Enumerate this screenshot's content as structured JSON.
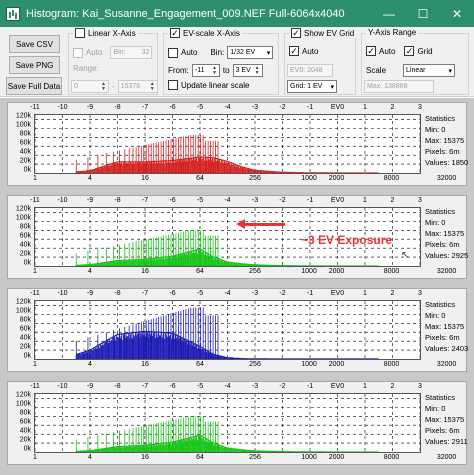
{
  "window": {
    "title": "Histogram: Kai_Susanne_Engagement_009.NEF Full-6064x4040",
    "minimize": "—",
    "maximize": "☐",
    "close": "✕"
  },
  "toolbar": {
    "save_csv": "Save CSV",
    "save_png": "Save PNG",
    "save_full": "Save Full Data",
    "linear_x": {
      "title": "Linear X-Axis",
      "checked": false,
      "auto_label": "Auto",
      "bin_label": "Bin:",
      "bin_value": "32",
      "range_label": "Range:",
      "range_from": "0",
      "range_to": "15376"
    },
    "ev_scale": {
      "title": "EV-scale X-Axis",
      "checked": true,
      "auto_label": "Auto",
      "bin_label": "Bin:",
      "bin_value": "1/32 EV",
      "from_label": "From:",
      "from_value": "-11",
      "to_label": "to",
      "to_value": "3 EV",
      "update_label": "Update linear scale"
    },
    "ev_grid": {
      "title": "Show EV Grid",
      "checked": true,
      "auto_label": "Auto",
      "ev0_value": "EV0: 2048",
      "grid_value": "Grid: 1 EV"
    },
    "y_axis": {
      "title": "Y-Axis Range",
      "auto_label": "Auto",
      "grid_label": "Grid",
      "scale_label": "Scale",
      "scale_value": "Linear",
      "max_value": "Max: 138888"
    }
  },
  "chart_common": {
    "ev_ticks": [
      "-11",
      "-10",
      "-9",
      "-8",
      "-7",
      "-6",
      "-5",
      "-4",
      "-3",
      "-2",
      "-1",
      "EV0",
      "1",
      "2",
      "3"
    ],
    "value_ticks": [
      "1",
      "4",
      "16",
      "64",
      "256",
      "1000",
      "2000",
      "8000",
      "32000"
    ],
    "y_ticks": [
      "120k",
      "100k",
      "80k",
      "60k",
      "40k",
      "20k",
      "0k"
    ]
  },
  "chart_data": [
    {
      "type": "area",
      "channel": "red",
      "color": "#d42020",
      "x": [
        -11,
        -10,
        -9,
        -8,
        -7,
        -6,
        -5,
        -4.5,
        -4,
        -3.5,
        -3,
        -2,
        -1,
        0,
        1,
        2,
        3
      ],
      "y": [
        0,
        0,
        5000,
        25000,
        25000,
        28000,
        36000,
        34000,
        26000,
        14000,
        6000,
        1500,
        300,
        0,
        0,
        0,
        0
      ],
      "spikes_max": 85000,
      "ylim": [
        0,
        130000
      ],
      "stats": {
        "title": "Statistics",
        "min": "Min: 0",
        "max": "Max: 15375",
        "pixels": "Pixels: 6m",
        "values": "Values: 1850"
      }
    },
    {
      "type": "area",
      "channel": "green",
      "color": "#16c416",
      "x": [
        -11,
        -10,
        -9,
        -8,
        -7,
        -6,
        -5,
        -4.5,
        -4,
        -3.5,
        -3,
        -2,
        -1,
        0,
        1,
        2,
        3
      ],
      "y": [
        0,
        0,
        3000,
        12000,
        15000,
        22000,
        38000,
        20000,
        9000,
        5000,
        2500,
        800,
        200,
        0,
        0,
        0,
        0
      ],
      "spikes_max": 80000,
      "ylim": [
        0,
        130000
      ],
      "stats": {
        "title": "Statistics",
        "min": "Min: 0",
        "max": "Max: 15375",
        "pixels": "Pixels: 6m",
        "values": "Values: 2925"
      }
    },
    {
      "type": "area",
      "channel": "blue",
      "color": "#1a1ab4",
      "x": [
        -11,
        -10,
        -9,
        -8,
        -7,
        -6,
        -5,
        -4.5,
        -4,
        -3.5,
        -3,
        -2,
        -1,
        0,
        1,
        2,
        3
      ],
      "y": [
        0,
        0,
        20000,
        55000,
        62000,
        58000,
        28000,
        10000,
        3000,
        800,
        200,
        0,
        0,
        0,
        0,
        0,
        0
      ],
      "spikes_max": 115000,
      "ylim": [
        0,
        130000
      ],
      "stats": {
        "title": "Statistics",
        "min": "Min: 0",
        "max": "Max: 15375",
        "pixels": "Pixels: 6m",
        "values": "Values: 2403"
      }
    },
    {
      "type": "area",
      "channel": "green",
      "color": "#16c416",
      "x": [
        -11,
        -10,
        -9,
        -8,
        -7,
        -6,
        -5,
        -4.5,
        -4,
        -3.5,
        -3,
        -2,
        -1,
        0,
        1,
        2,
        3
      ],
      "y": [
        0,
        0,
        3000,
        12000,
        15000,
        22000,
        38000,
        20000,
        9000,
        5000,
        2500,
        800,
        200,
        0,
        0,
        0,
        0
      ],
      "spikes_max": 80000,
      "ylim": [
        0,
        130000
      ],
      "stats": {
        "title": "Statistics",
        "min": "Min: 0",
        "max": "Max: 15375",
        "pixels": "Pixels: 6m",
        "values": "Values: 2911"
      }
    }
  ],
  "annotation": {
    "text": "~3 EV Exposure",
    "color": "#e8343a"
  }
}
